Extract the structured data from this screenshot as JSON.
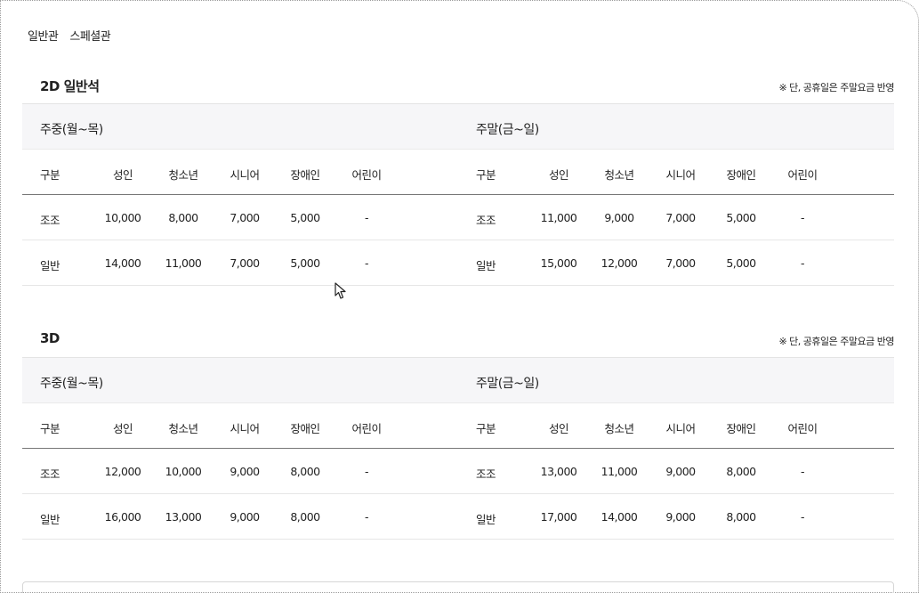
{
  "tabs": [
    "일반관",
    "스페셜관"
  ],
  "columns": [
    "구분",
    "성인",
    "청소년",
    "시니어",
    "장애인",
    "어린이"
  ],
  "note": "※ 단, 공휴일은 주말요금 반영",
  "sections": [
    {
      "title": "2D 일반석",
      "weekday": {
        "label": "주중(월~목)",
        "rows": [
          [
            "조조",
            "10,000",
            "8,000",
            "7,000",
            "5,000",
            "-"
          ],
          [
            "일반",
            "14,000",
            "11,000",
            "7,000",
            "5,000",
            "-"
          ]
        ]
      },
      "weekend": {
        "label": "주말(금~일)",
        "rows": [
          [
            "조조",
            "11,000",
            "9,000",
            "7,000",
            "5,000",
            "-"
          ],
          [
            "일반",
            "15,000",
            "12,000",
            "7,000",
            "5,000",
            "-"
          ]
        ]
      }
    },
    {
      "title": "3D",
      "weekday": {
        "label": "주중(월~목)",
        "rows": [
          [
            "조조",
            "12,000",
            "10,000",
            "9,000",
            "8,000",
            "-"
          ],
          [
            "일반",
            "16,000",
            "13,000",
            "9,000",
            "8,000",
            "-"
          ]
        ]
      },
      "weekend": {
        "label": "주말(금~일)",
        "rows": [
          [
            "조조",
            "13,000",
            "11,000",
            "9,000",
            "8,000",
            "-"
          ],
          [
            "일반",
            "17,000",
            "14,000",
            "9,000",
            "8,000",
            "-"
          ]
        ]
      }
    }
  ]
}
